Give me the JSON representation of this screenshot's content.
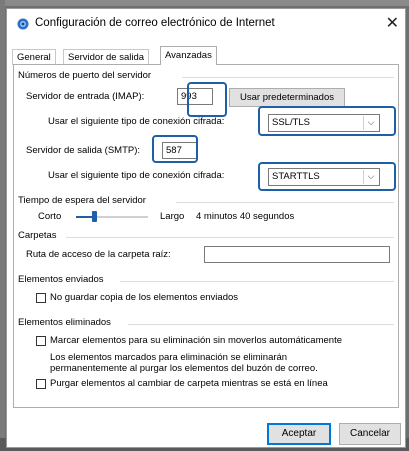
{
  "window": {
    "title": "Configuración de correo electrónico de Internet",
    "close_glyph": "✕",
    "title_icon": "mail-settings-icon"
  },
  "tabs": [
    {
      "label": "General",
      "active": false
    },
    {
      "label": "Servidor de salida",
      "active": false
    },
    {
      "label": "Avanzadas",
      "active": true
    }
  ],
  "ports": {
    "section_title": "Números de puerto del servidor",
    "incoming_label": "Servidor de entrada (IMAP):",
    "incoming_value": "993",
    "defaults_button": "Usar predeterminados",
    "incoming_enc_label": "Usar el siguiente tipo de conexión cifrada:",
    "incoming_enc_value": "SSL/TLS",
    "outgoing_label": "Servidor de salida (SMTP):",
    "outgoing_value": "587",
    "outgoing_enc_label": "Usar el siguiente tipo de conexión cifrada:",
    "outgoing_enc_value": "STARTTLS"
  },
  "timeout": {
    "section_title": "Tiempo de espera del servidor",
    "short_label": "Corto",
    "long_label": "Largo",
    "value_text": "4 minutos 40 segundos",
    "slider_level": 0.25
  },
  "folders": {
    "section_title": "Carpetas",
    "root_label": "Ruta de acceso de la carpeta raíz:",
    "root_value": ""
  },
  "sent": {
    "section_title": "Elementos enviados",
    "no_copy_label": "No guardar copia de los elementos enviados",
    "no_copy_checked": false
  },
  "deleted": {
    "section_title": "Elementos eliminados",
    "mark_label": "Marcar elementos para su eliminación sin moverlos automáticamente",
    "mark_checked": false,
    "note_line1": "Los elementos marcados para eliminación se eliminarán",
    "note_line2": "permanentemente al purgar los elementos del buzón de correo.",
    "purge_label": "Purgar elementos al cambiar de carpeta mientras se está en línea",
    "purge_checked": false
  },
  "footer": {
    "accept": "Aceptar",
    "cancel": "Cancelar"
  },
  "colors": {
    "highlight": "#1f5fa8",
    "default_button_border": "#0078d7"
  }
}
